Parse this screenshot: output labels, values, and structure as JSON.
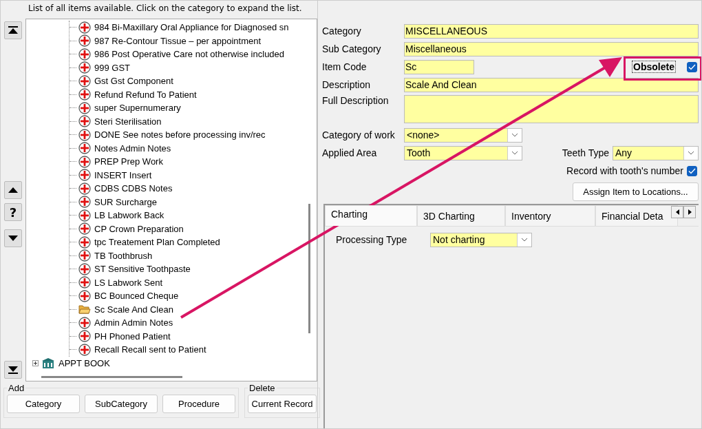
{
  "caption": "List of all items available. Click on the category to expand the list.",
  "side_buttons": [
    {
      "kind": "top"
    },
    {
      "kind": "up"
    },
    {
      "kind": "help",
      "label": "?"
    },
    {
      "kind": "down"
    },
    {
      "kind": "bottom"
    }
  ],
  "tree": {
    "items": [
      {
        "label": "984 Bi-Maxillary Oral Appliance for Diagnosed sn",
        "kind": "procedure"
      },
      {
        "label": "987 Re-Contour Tissue  – per appointment",
        "kind": "procedure"
      },
      {
        "label": "986 Post Operative Care not otherwise included",
        "kind": "procedure"
      },
      {
        "label": "999 GST",
        "kind": "procedure"
      },
      {
        "label": "Gst Gst Component",
        "kind": "procedure"
      },
      {
        "label": "Refund Refund To Patient",
        "kind": "procedure"
      },
      {
        "label": "super Supernumerary",
        "kind": "procedure"
      },
      {
        "label": "Steri Sterilisation",
        "kind": "procedure"
      },
      {
        "label": "DONE See notes before processing inv/rec",
        "kind": "procedure"
      },
      {
        "label": "Notes Admin Notes",
        "kind": "procedure"
      },
      {
        "label": "PREP Prep Work",
        "kind": "procedure"
      },
      {
        "label": "INSERT Insert",
        "kind": "procedure"
      },
      {
        "label": "CDBS CDBS Notes",
        "kind": "procedure"
      },
      {
        "label": "SUR Surcharge",
        "kind": "procedure"
      },
      {
        "label": "LB Labwork Back",
        "kind": "procedure"
      },
      {
        "label": "CP Crown Preparation",
        "kind": "procedure"
      },
      {
        "label": "tpc Treatement Plan Completed",
        "kind": "procedure"
      },
      {
        "label": "TB Toothbrush",
        "kind": "procedure"
      },
      {
        "label": "ST Sensitive Toothpaste",
        "kind": "procedure"
      },
      {
        "label": "LS Labwork Sent",
        "kind": "procedure"
      },
      {
        "label": "BC Bounced Cheque",
        "kind": "procedure"
      },
      {
        "label": "Sc Scale And Clean",
        "kind": "folder"
      },
      {
        "label": "Admin Admin Notes",
        "kind": "procedure"
      },
      {
        "label": "PH Phoned Patient",
        "kind": "procedure"
      },
      {
        "label": "Recall Recall sent to Patient",
        "kind": "procedure"
      }
    ],
    "next_category": {
      "label": "APPT BOOK",
      "expanded": false
    }
  },
  "add_group": {
    "title": "Add",
    "buttons": [
      "Category",
      "SubCategory",
      "Procedure"
    ]
  },
  "delete_group": {
    "title": "Delete",
    "buttons": [
      "Current Record"
    ]
  },
  "form": {
    "category": {
      "label": "Category",
      "value": "MISCELLANEOUS"
    },
    "sub_category": {
      "label": "Sub Category",
      "value": "Miscellaneous"
    },
    "item_code": {
      "label": "Item Code",
      "value": "Sc"
    },
    "obsolete": {
      "label": "Obsolete",
      "checked": true
    },
    "description": {
      "label": "Description",
      "value": "Scale And Clean"
    },
    "full_description": {
      "label": "Full Description"
    },
    "category_of_work": {
      "label": "Category of work",
      "value": "<none>"
    },
    "applied_area": {
      "label": "Applied Area",
      "value": "Tooth"
    },
    "teeth_type": {
      "label": "Teeth Type",
      "value": "Any"
    },
    "record_tooth_number": {
      "label": "Record with tooth's number",
      "checked": true
    },
    "assign_button": "Assign Item to Locations..."
  },
  "tabs": [
    {
      "label": "Charting",
      "selected": true
    },
    {
      "label": "3D Charting",
      "selected": false
    },
    {
      "label": "Inventory",
      "selected": false
    },
    {
      "label": "Financial Deta",
      "selected": false
    }
  ],
  "charting": {
    "processing_type": {
      "label": "Processing Type",
      "value": "Not charting"
    }
  }
}
